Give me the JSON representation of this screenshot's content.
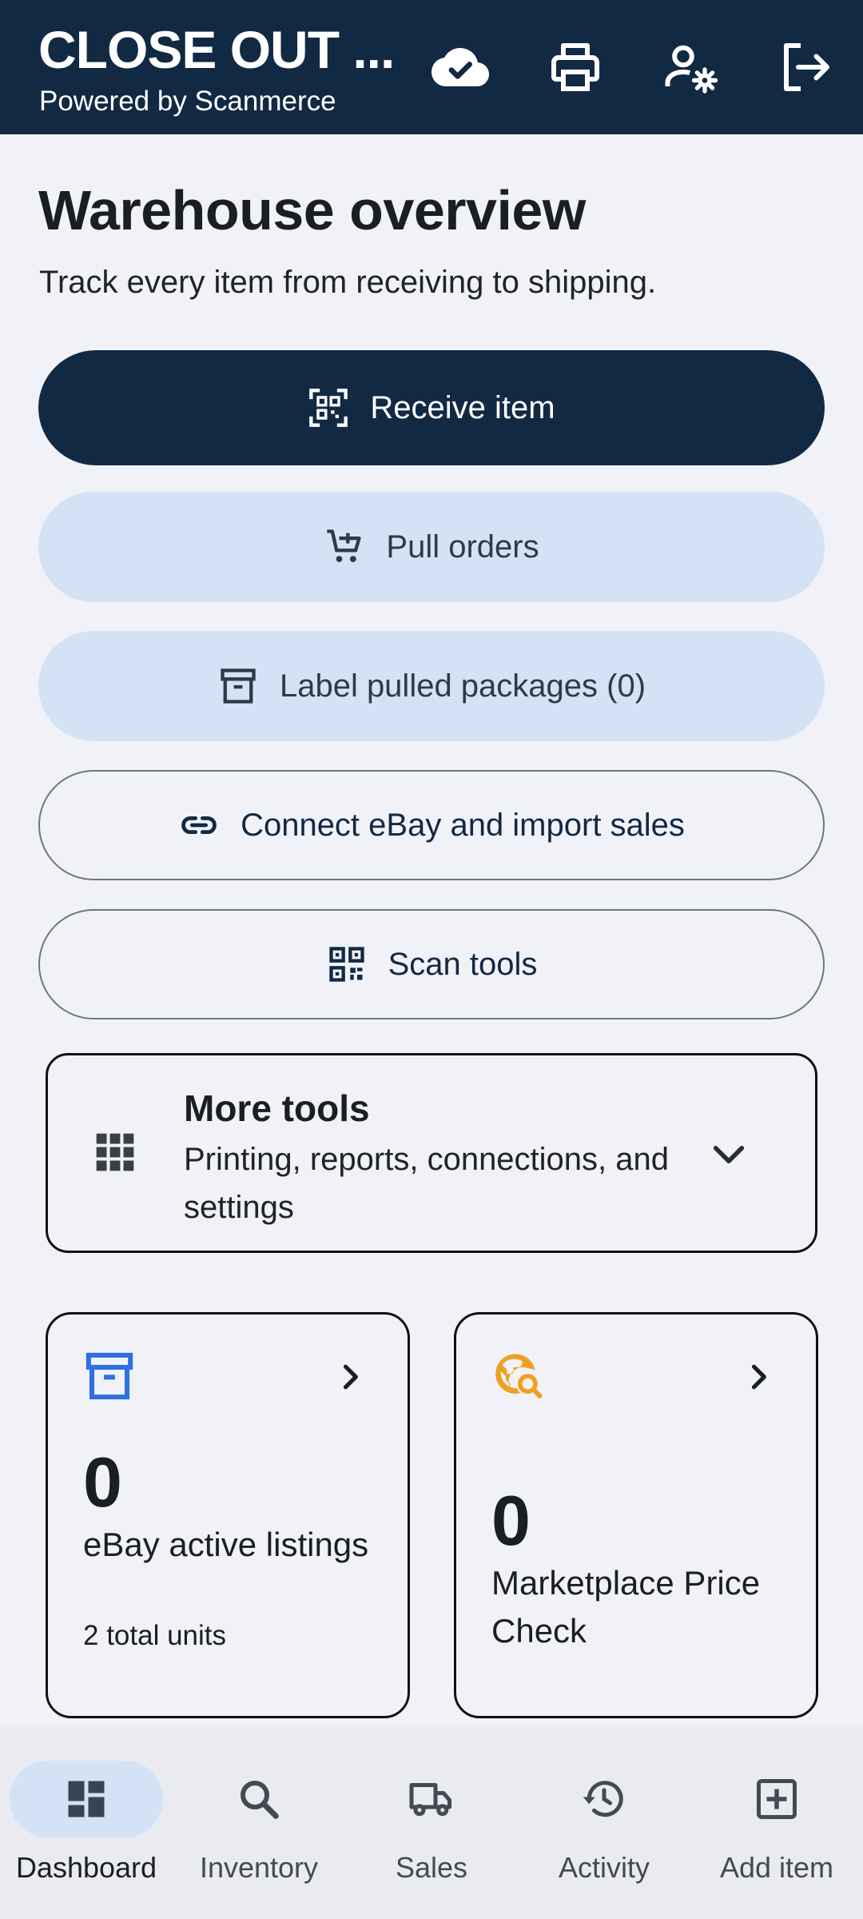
{
  "header": {
    "title": "CLOSE OUT ...",
    "subtitle": "Powered by Scanmerce",
    "actions": [
      {
        "icon": "cloud-check-icon"
      },
      {
        "icon": "printer-icon"
      },
      {
        "icon": "user-settings-icon"
      },
      {
        "icon": "logout-icon"
      }
    ]
  },
  "main": {
    "title": "Warehouse overview",
    "subtitle": "Track every item from receiving to shipping.",
    "buttons": {
      "receive": {
        "label": "Receive item",
        "icon": "qr-scan-icon"
      },
      "pull": {
        "label": "Pull orders",
        "icon": "cart-icon"
      },
      "label_pulled": {
        "label": "Label pulled packages (0)",
        "icon": "archive-box-icon"
      },
      "connect_ebay": {
        "label": "Connect eBay and import sales",
        "icon": "link-icon"
      },
      "scan_tools": {
        "label": "Scan tools",
        "icon": "qr-code-icon"
      }
    },
    "more_tools": {
      "title": "More tools",
      "description": "Printing, reports, connections, and settings",
      "icon": "grid-icon"
    },
    "stats": [
      {
        "value": "0",
        "label": "eBay active listings",
        "sub": "2 total units",
        "icon": "archive-box-icon",
        "icon_color": "#2f6fe0"
      },
      {
        "value": "0",
        "label": "Marketplace Price Check",
        "sub": "",
        "icon": "globe-search-icon",
        "icon_color": "#f0a020"
      }
    ]
  },
  "bottom_nav": {
    "items": [
      {
        "label": "Dashboard",
        "icon": "dashboard-icon",
        "active": true
      },
      {
        "label": "Inventory",
        "icon": "search-icon",
        "active": false
      },
      {
        "label": "Sales",
        "icon": "truck-icon",
        "active": false
      },
      {
        "label": "Activity",
        "icon": "history-icon",
        "active": false
      },
      {
        "label": "Add item",
        "icon": "add-box-icon",
        "active": false
      }
    ]
  },
  "colors": {
    "primary": "#122944",
    "tonal": "#d3e2f5",
    "background": "#f0f2f7",
    "nav_background": "#e9ebf1"
  }
}
